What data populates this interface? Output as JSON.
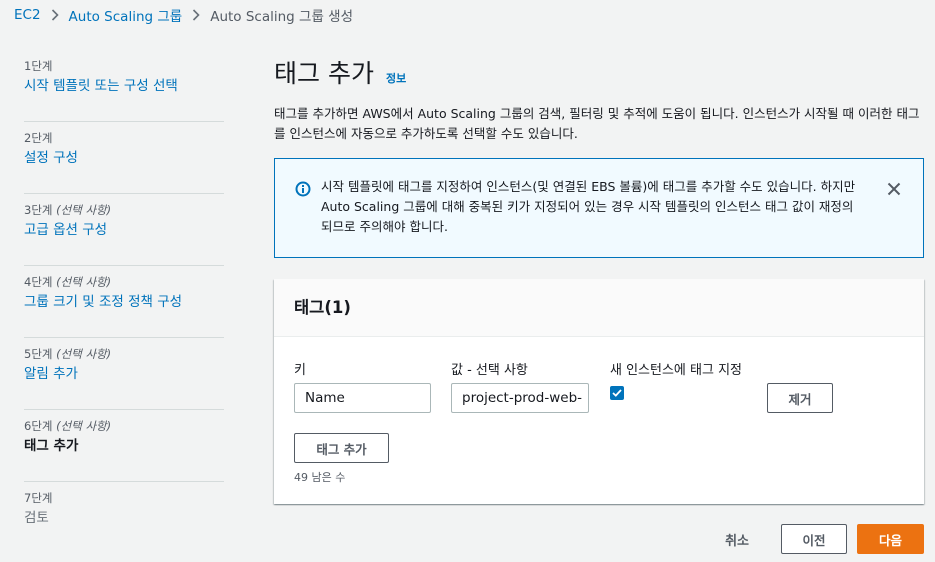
{
  "breadcrumb": {
    "items": [
      "EC2",
      "Auto Scaling 그룹"
    ],
    "current": "Auto Scaling 그룹 생성"
  },
  "steps": [
    {
      "num": "1단계",
      "optional": "",
      "label": "시작 템플릿 또는 구성 선택",
      "state": "link"
    },
    {
      "num": "2단계",
      "optional": "",
      "label": "설정 구성",
      "state": "link"
    },
    {
      "num": "3단계",
      "optional": "(선택 사항)",
      "label": "고급 옵션 구성",
      "state": "link"
    },
    {
      "num": "4단계",
      "optional": "(선택 사항)",
      "label": "그룹 크기 및 조정 정책 구성",
      "state": "link"
    },
    {
      "num": "5단계",
      "optional": "(선택 사항)",
      "label": "알림 추가",
      "state": "link"
    },
    {
      "num": "6단계",
      "optional": "(선택 사항)",
      "label": "태그 추가",
      "state": "active"
    },
    {
      "num": "7단계",
      "optional": "",
      "label": "검토",
      "state": "disabled"
    }
  ],
  "page": {
    "title": "태그 추가",
    "info_link": "정보",
    "description": "태그를 추가하면 AWS에서 Auto Scaling 그룹의 검색, 필터링 및 추적에 도움이 됩니다. 인스턴스가 시작될 때 이러한 태그를 인스턴스에 자동으로 추가하도록 선택할 수도 있습니다."
  },
  "alert": {
    "line1": "시작 템플릿에 태그를 지정하여 인스턴스(및 연결된 EBS 볼륨)에 태그를 추가할 수도 있습니다. 하지만",
    "line2": "Auto Scaling 그룹에 대해 중복된 키가 지정되어 있는 경우 시작 템플릿의 인스턴스 태그 값이 재정의",
    "line3": "되므로 주의해야 합니다."
  },
  "tags_panel": {
    "header": "태그(1)",
    "key_label": "키",
    "value_label": "값 - 선택 사항",
    "propagate_label": "새 인스턴스에 태그 지정",
    "key_value": "Name",
    "value_value": "project-prod-web-",
    "propagate_checked": true,
    "remove_button": "제거",
    "add_button": "태그 추가",
    "remaining": "49 남은 수"
  },
  "footer": {
    "cancel": "취소",
    "previous": "이전",
    "next": "다음"
  },
  "colors": {
    "link": "#0073bb",
    "primary": "#ec7211",
    "alert_bg": "#f1faff"
  }
}
